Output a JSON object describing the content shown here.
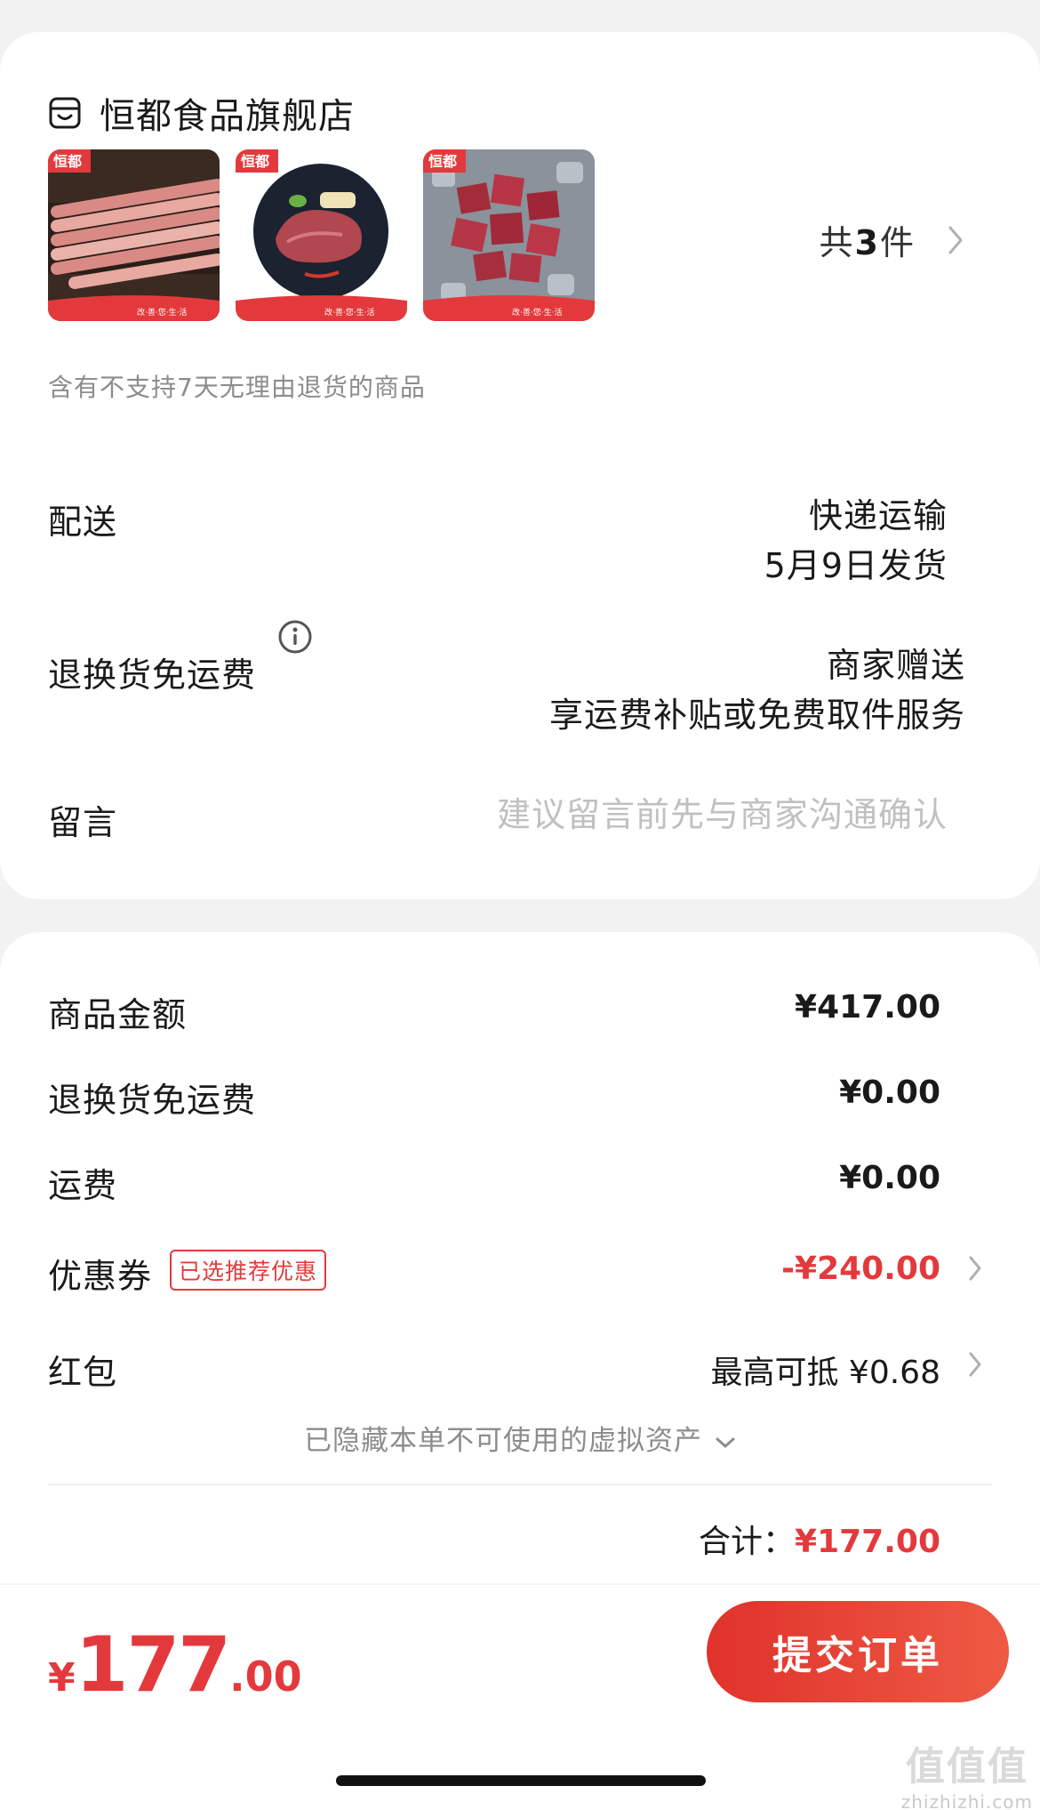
{
  "store": {
    "name": "恒都食品旗舰店",
    "thumbnails": [
      {
        "brand": "恒都",
        "strip": "改·善·您·生·活"
      },
      {
        "brand": "恒都",
        "strip": "改·善·您·生·活"
      },
      {
        "brand": "恒都",
        "strip": "改·善·您·生·活"
      }
    ],
    "count_prefix": "共",
    "count_value": "3",
    "count_suffix": "件",
    "notice": "含有不支持7天无理由退货的商品"
  },
  "delivery": {
    "label": "配送",
    "method": "快递运输",
    "ship_date": "5月9日发货"
  },
  "return_shipping": {
    "label": "退换货免运费",
    "line1": "商家赠送",
    "line2": "享运费补贴或免费取件服务"
  },
  "message": {
    "label": "留言",
    "placeholder": "建议留言前先与商家沟通确认"
  },
  "price": {
    "goods_label": "商品金额",
    "goods_value": "¥417.00",
    "return_fee_label": "退换货免运费",
    "return_fee_value": "¥0.00",
    "shipping_label": "运费",
    "shipping_value": "¥0.00",
    "coupon_label": "优惠券",
    "coupon_badge": "已选推荐优惠",
    "coupon_value": "-¥240.00",
    "redpacket_label": "红包",
    "redpacket_value": "最高可抵 ¥0.68",
    "hidden_note": "已隐藏本单不可使用的虚拟资产",
    "total_label": "合计：",
    "total_value": "¥177.00"
  },
  "bottom": {
    "currency": "¥",
    "price_int": "177",
    "price_dec": ".00",
    "submit_label": "提交订单"
  },
  "watermark": {
    "top": "值值值",
    "bottom": "zhizhizhi.com"
  },
  "colors": {
    "accent": "#e4393c",
    "button_start": "#e0322b",
    "button_end": "#ee5a44",
    "background": "#f2f2f2"
  }
}
